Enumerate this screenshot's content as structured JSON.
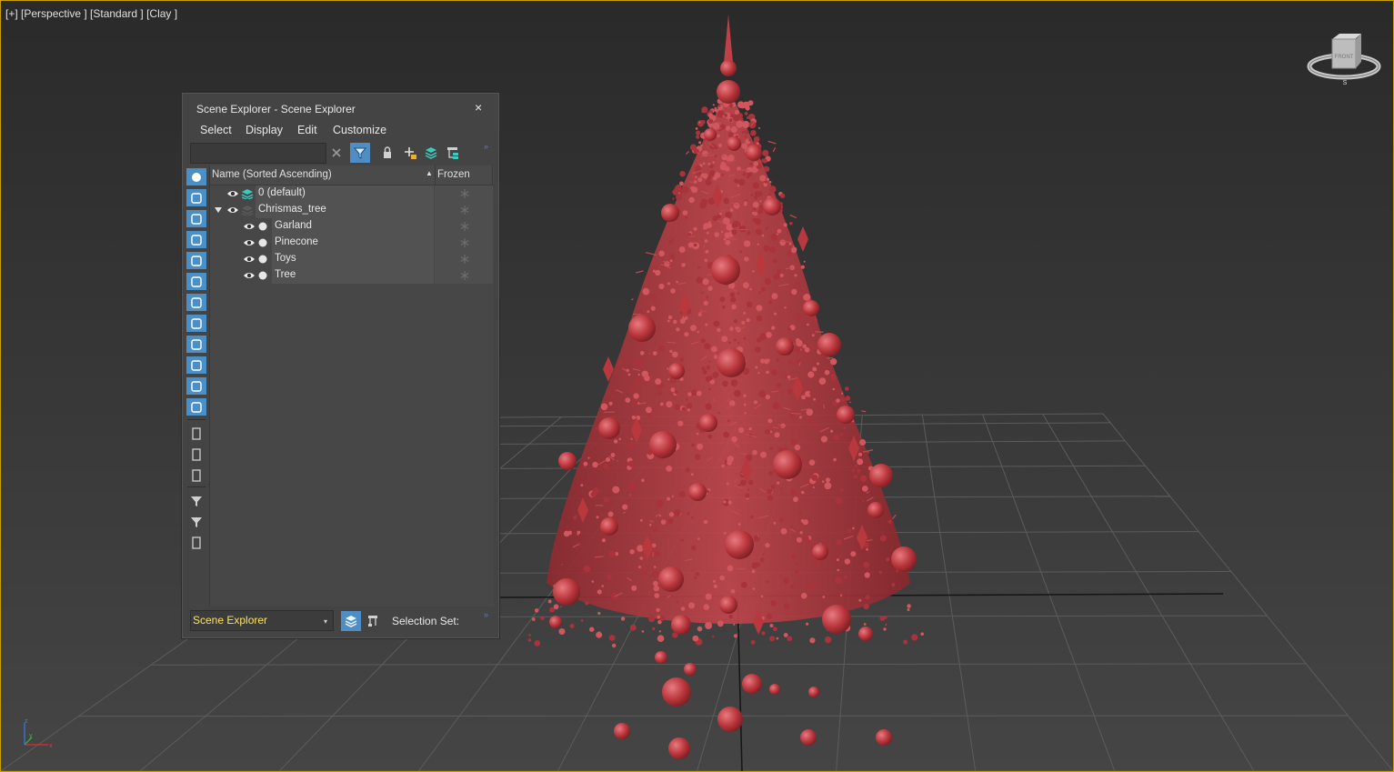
{
  "viewport": {
    "label": "[+] [Perspective ] [Standard ] [Clay ]",
    "viewcube_face": "FRONT",
    "viewcube_compass": "S",
    "colors": {
      "border": "#c8a000",
      "tree": "#b33a3f",
      "grid": "#5a5a5a"
    }
  },
  "scene_explorer": {
    "title": "Scene Explorer - Scene Explorer",
    "close": "×",
    "menu": [
      "Select",
      "Display",
      "Edit",
      "Customize"
    ],
    "toolbar_icons": [
      "clear-search-icon",
      "filter-icon",
      "lock-icon",
      "add-layer-icon",
      "layers-icon",
      "hierarchy-icon"
    ],
    "sidebar_icons": [
      "geometry-icon",
      "shapes-icon",
      "lights-icon",
      "cameras-icon",
      "helpers-icon",
      "spacewarps-icon",
      "groups-icon",
      "xrefs-icon",
      "bones-icon",
      "containers-icon",
      "frozen-icon",
      "hidden-icon",
      "all-icon",
      "none-icon",
      "invert-icon",
      "filter-options-icon",
      "filter-icon",
      "selection-icon"
    ],
    "columns": {
      "name": "Name (Sorted Ascending)",
      "frozen": "Frozen"
    },
    "rows": [
      {
        "label": "0 (default)",
        "level": 0,
        "type": "layer-default"
      },
      {
        "label": "Chrismas_tree",
        "level": 0,
        "type": "layer",
        "expanded": true
      },
      {
        "label": "Garland",
        "level": 1,
        "type": "object"
      },
      {
        "label": "Pinecone",
        "level": 1,
        "type": "object"
      },
      {
        "label": "Toys",
        "level": 1,
        "type": "object"
      },
      {
        "label": "Tree",
        "level": 1,
        "type": "object"
      }
    ],
    "bottom": {
      "dropdown_value": "Scene Explorer",
      "selection_set_label": "Selection Set:"
    },
    "colors": {
      "accent": "#4b8fc7",
      "dropdown_text": "#ffe35a"
    }
  }
}
